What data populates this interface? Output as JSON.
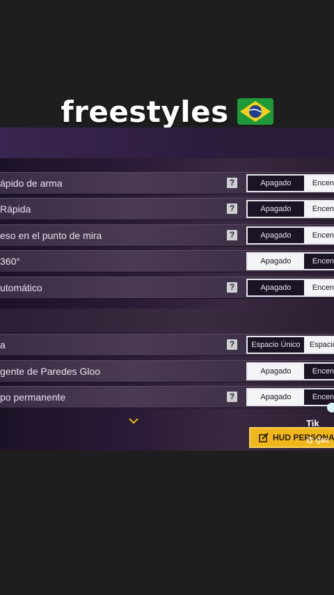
{
  "caption": {
    "text": "freestyles",
    "flag_icon": "brazil-flag-icon"
  },
  "colors": {
    "accent": "#f0b71c",
    "panel": "#3a2e46",
    "selected": "#f4f4f6"
  },
  "section1": [
    {
      "label": "ápido de arma",
      "help": "?",
      "left": "Apagado",
      "right": "Encen",
      "selected": "right"
    },
    {
      "label": "Rápida",
      "help": "?",
      "left": "Apagado",
      "right": "Encen",
      "selected": "right"
    },
    {
      "label": "eso en el punto de mira",
      "help": "?",
      "left": "Apagado",
      "right": "Encen",
      "selected": "right"
    },
    {
      "label": "360°",
      "help": "",
      "left": "Apagado",
      "right": "Encen",
      "selected": "left"
    },
    {
      "label": "utomático",
      "help": "?",
      "left": "Apagado",
      "right": "Encen",
      "selected": "right"
    }
  ],
  "section2": [
    {
      "label": "a",
      "help": "?",
      "left": "Espacio Único",
      "right": "Espacio",
      "selected": "right"
    },
    {
      "label": "gente de Paredes Gloo",
      "help": "",
      "left": "Apagado",
      "right": "Encen",
      "selected": "left"
    },
    {
      "label": "po permanente",
      "help": "?",
      "left": "Apagado",
      "right": "Encen",
      "selected": "left"
    }
  ],
  "hud_button": {
    "label": "HUD PERSONALI",
    "icon": "edit-icon"
  },
  "watermark": {
    "tiktok": "Tik",
    "user": "@ gaa"
  }
}
